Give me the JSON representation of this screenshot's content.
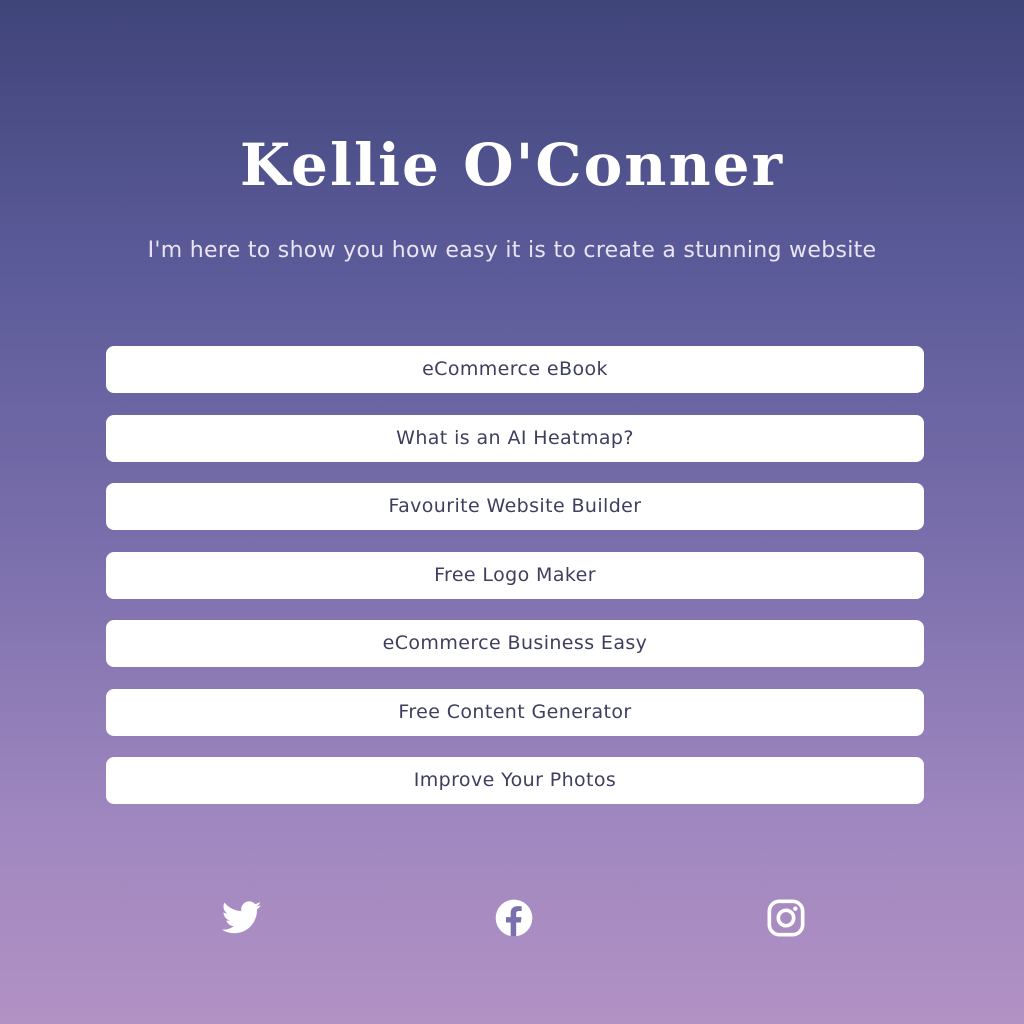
{
  "profile": {
    "name": "Kellie O'Conner",
    "tagline": "I'm here to show you how easy it is to create a stunning website"
  },
  "links": [
    {
      "label": "eCommerce eBook"
    },
    {
      "label": "What is an AI Heatmap?"
    },
    {
      "label": "Favourite Website Builder"
    },
    {
      "label": "Free Logo Maker"
    },
    {
      "label": "eCommerce Business Easy"
    },
    {
      "label": "Free Content Generator"
    },
    {
      "label": "Improve Your Photos"
    }
  ],
  "social": [
    {
      "icon": "twitter-icon"
    },
    {
      "icon": "facebook-icon"
    },
    {
      "icon": "instagram-icon"
    }
  ],
  "colors": {
    "background_top": "#3f4479",
    "background_bottom": "#b291c4",
    "button_bg": "#ffffff",
    "button_text": "#3e3e5e",
    "title_text": "#ffffff"
  }
}
